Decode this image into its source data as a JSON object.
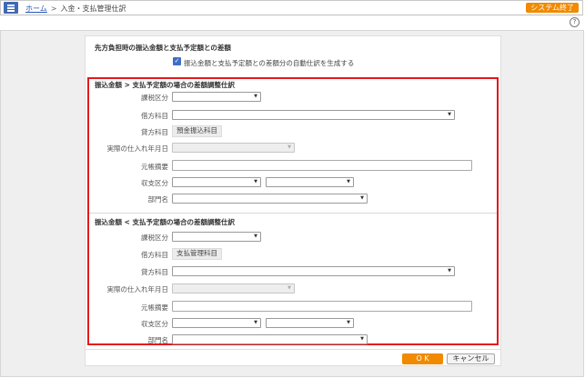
{
  "header": {
    "breadcrumb_home": "ホーム",
    "breadcrumb_sep": ">",
    "breadcrumb_current": "入金・支払管理仕訳",
    "system_end": "システム終了",
    "help": "?"
  },
  "settings": {
    "title": "先方負担時の振込金額と支払予定額との差額",
    "auto_checkbox_label": "振込金額と支払予定額との差額分の自動仕訳を生成する",
    "auto_checked": true
  },
  "section1": {
    "title": "振込金額 > 支払予定額の場合の差額調整仕訳",
    "tax_label": "課税区分",
    "debit_label": "借方科目",
    "credit_label": "貸方科目",
    "credit_value": "預金振込科目",
    "date_label": "実際の仕入れ年月日",
    "memo_label": "元帳摘要",
    "income_label": "収支区分",
    "dept_label": "部門名"
  },
  "section2": {
    "title": "振込金額 < 支払予定額の場合の差額調整仕訳",
    "tax_label": "課税区分",
    "debit_label": "借方科目",
    "debit_value": "支払管理科目",
    "credit_label": "貸方科目",
    "date_label": "実際の仕入れ年月日",
    "memo_label": "元帳摘要",
    "income_label": "収支区分",
    "dept_label": "部門名"
  },
  "footer": {
    "ok": "O K",
    "cancel": "キャンセル"
  },
  "colors": {
    "accent": "#f08a00",
    "menu": "#3f69b5",
    "highlight_border": "#e3191b",
    "checkbox": "#3e6fc3"
  },
  "icons": [
    "menu-icon",
    "help-icon",
    "check-icon",
    "dropdown-arrow-icon"
  ]
}
